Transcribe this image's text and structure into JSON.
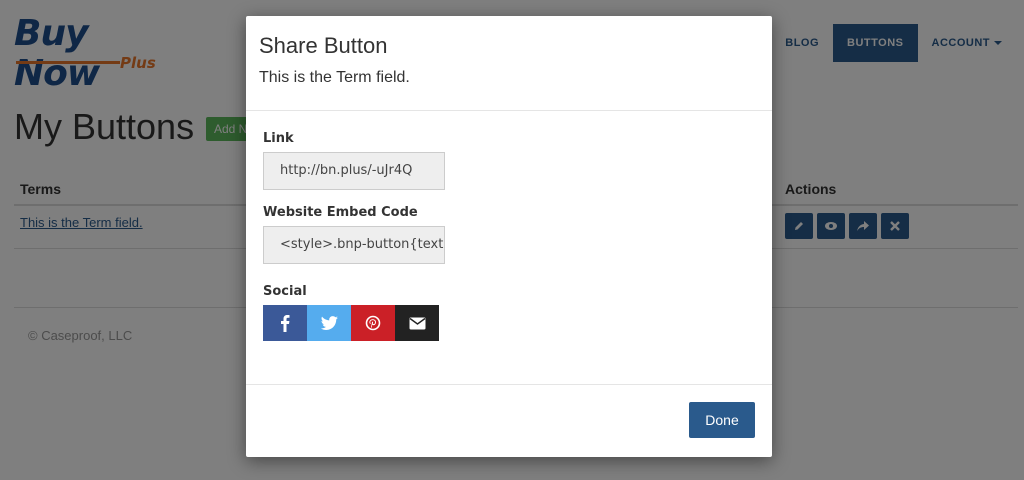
{
  "header": {
    "logo_text": "Buy Now",
    "logo_sub": "Plus",
    "nav": [
      {
        "label": "BLOG"
      },
      {
        "label": "BUTTONS"
      },
      {
        "label": "ACCOUNT"
      }
    ]
  },
  "main": {
    "title": "My Buttons",
    "add_new_label": "Add N",
    "table": {
      "headers": [
        "Terms",
        "Actions"
      ],
      "rows": [
        {
          "term": "This is the Term field."
        }
      ]
    },
    "actions_icons": [
      "pencil-icon",
      "eye-icon",
      "share-icon",
      "close-icon"
    ]
  },
  "footer": {
    "text": "© Caseproof, LLC"
  },
  "modal": {
    "title": "Share Button",
    "subtitle": "This is the Term field.",
    "link_label": "Link",
    "link_value": "http://bn.plus/-uJr4Q",
    "embed_label": "Website Embed Code",
    "embed_value": "<style>.bnp-button{text-",
    "social_label": "Social",
    "social": [
      {
        "icon": "facebook-icon",
        "color": "#3b5998"
      },
      {
        "icon": "twitter-icon",
        "color": "#55acee"
      },
      {
        "icon": "pinterest-icon",
        "color": "#cb2027"
      },
      {
        "icon": "email-icon",
        "color": "#222222"
      }
    ],
    "done_label": "Done"
  },
  "colors": {
    "primary": "#2a5a8c",
    "logo_blue": "#1f4e8c",
    "logo_orange": "#e8762b",
    "add_green": "#5cb85c"
  }
}
